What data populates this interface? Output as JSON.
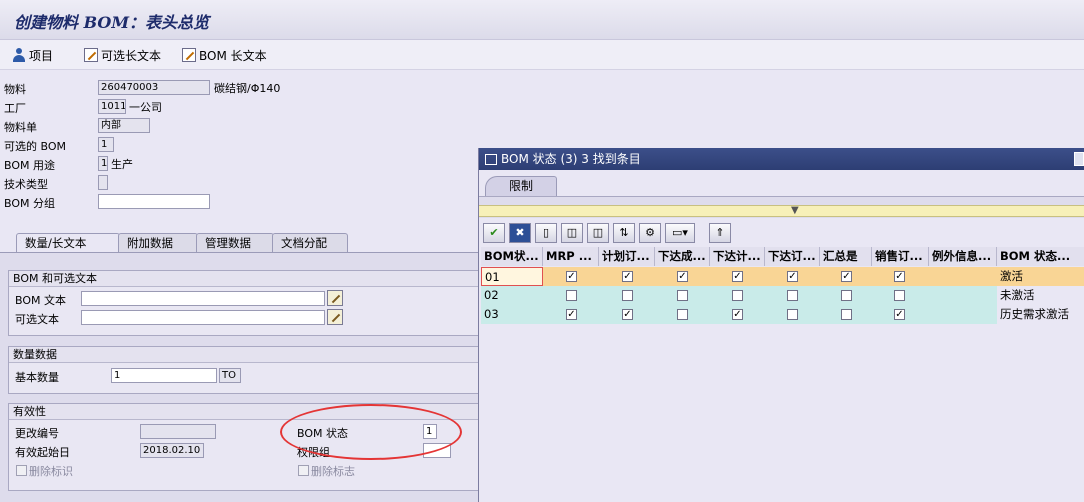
{
  "title": "创建物料 BOM：表头总览",
  "toolbar": {
    "item": "项目",
    "alt_text": "可选长文本",
    "bom_text": "BOM 长文本"
  },
  "header": {
    "material_label": "物料",
    "material_value": "260470003",
    "material_desc": "碳结钢/Φ140",
    "plant_label": "工厂",
    "plant_value": "1011",
    "plant_desc": "一公司",
    "doc_label": "物料单",
    "doc_value": "内部",
    "alt_bom_label": "可选的 BOM",
    "alt_bom_value": "1",
    "usage_label": "BOM 用途",
    "usage_value": "1",
    "usage_desc": "生产",
    "tech_label": "技术类型",
    "tech_value": "",
    "group_label": "BOM 分组",
    "group_value": ""
  },
  "tabs": [
    "数量/长文本",
    "附加数据",
    "管理数据",
    "文档分配"
  ],
  "groups": {
    "text": {
      "title": "BOM 和可选文本",
      "bom_text_label": "BOM 文本",
      "alt_text_label": "可选文本"
    },
    "qty": {
      "title": "数量数据",
      "base_qty_label": "基本数量",
      "base_qty_value": "1",
      "unit_value": "TO"
    },
    "validity": {
      "title": "有效性",
      "change_no_label": "更改编号",
      "change_no_value": "",
      "valid_from_label": "有效起始日",
      "valid_from_value": "2018.02.10",
      "delete_label": "删除标识",
      "bom_status_label": "BOM 状态",
      "bom_status_value": "1",
      "auth_group_label": "权限组",
      "auth_group_value": "",
      "delete_flag_label": "删除标志"
    }
  },
  "dialog": {
    "title": "BOM 状态 (3)   3 找到条目",
    "tab": "限制",
    "columns": [
      "BOM状...",
      "MRP ...",
      "计划订...",
      "下达成...",
      "下达计...",
      "下达订...",
      "汇总是",
      "销售订...",
      "例外信息...",
      "BOM 状态..."
    ],
    "rows": [
      {
        "code": "01",
        "checks": [
          true,
          true,
          true,
          true,
          true,
          true,
          true
        ],
        "desc": "激活"
      },
      {
        "code": "02",
        "checks": [
          false,
          false,
          false,
          false,
          false,
          false,
          false
        ],
        "desc": "未激活"
      },
      {
        "code": "03",
        "checks": [
          true,
          true,
          false,
          true,
          false,
          false,
          true
        ],
        "desc": "历史需求激活"
      }
    ]
  }
}
